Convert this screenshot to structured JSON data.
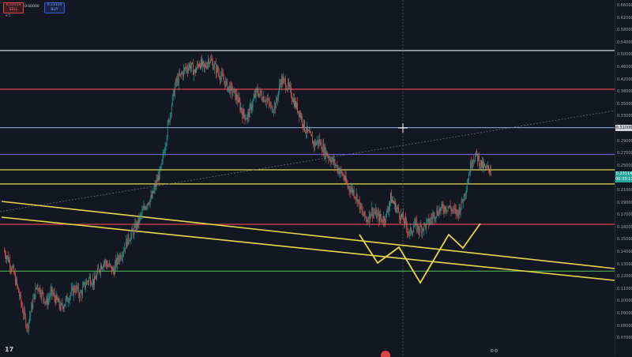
{
  "toolbar": {
    "sell": {
      "price": "0.23114",
      "label": "SELL"
    },
    "spread": "0.00000",
    "buy": {
      "price": "0.23114",
      "label": "BUY"
    },
    "interval": "5"
  },
  "price_axis": {
    "ticks": [
      "0.66000",
      "0.62000",
      "0.58000",
      "0.54000",
      "0.50000",
      "0.46000",
      "0.42000",
      "0.38000",
      "0.35000",
      "0.33000",
      "0.31000",
      "0.29000",
      "0.27000",
      "0.25000",
      "0.23000",
      "0.21000",
      "0.19000",
      "0.17000",
      "0.16000",
      "0.15000",
      "0.14000",
      "0.13000",
      "0.12000",
      "0.11000",
      "0.10000",
      "0.09000",
      "0.08000",
      "0.07000"
    ],
    "crosshair_label": "0.31006",
    "last_price_label": "0.23114",
    "last_price_sub": "00:33:17"
  },
  "colors": {
    "background": "#131722",
    "up_candle": "#26a69a",
    "down_candle": "#ef5350",
    "white_level": "#d1d4dc",
    "red_level": "#e0434b",
    "blue_level": "#7ea7e6",
    "purple_level": "#6a5acd",
    "yellow": "#e6d84a",
    "green_level": "#4caf50"
  },
  "icons": {
    "logo": "tradingview-logo-icon",
    "bottom": "settings-icon"
  },
  "chart_data": {
    "type": "candlestick",
    "y_scale": "log",
    "ylim": [
      0.07,
      0.66
    ],
    "horizontal_levels": [
      {
        "price": 0.495,
        "color": "white"
      },
      {
        "price": 0.385,
        "color": "red"
      },
      {
        "price": 0.3,
        "color": "blue"
      },
      {
        "price": 0.252,
        "color": "purple"
      },
      {
        "price": 0.228,
        "color": "yellow"
      },
      {
        "price": 0.208,
        "color": "yellow"
      },
      {
        "price": 0.16,
        "color": "red"
      },
      {
        "price": 0.118,
        "color": "green"
      }
    ],
    "price_path": [
      0.135,
      0.128,
      0.118,
      0.105,
      0.092,
      0.082,
      0.095,
      0.108,
      0.102,
      0.096,
      0.103,
      0.098,
      0.093,
      0.097,
      0.102,
      0.106,
      0.101,
      0.108,
      0.113,
      0.11,
      0.12,
      0.126,
      0.122,
      0.118,
      0.128,
      0.135,
      0.145,
      0.152,
      0.16,
      0.172,
      0.185,
      0.19,
      0.21,
      0.23,
      0.28,
      0.34,
      0.4,
      0.42,
      0.44,
      0.45,
      0.43,
      0.46,
      0.44,
      0.47,
      0.45,
      0.43,
      0.41,
      0.39,
      0.38,
      0.36,
      0.33,
      0.32,
      0.35,
      0.38,
      0.37,
      0.36,
      0.34,
      0.35,
      0.41,
      0.4,
      0.38,
      0.35,
      0.33,
      0.3,
      0.285,
      0.27,
      0.275,
      0.26,
      0.25,
      0.24,
      0.23,
      0.22,
      0.205,
      0.2,
      0.19,
      0.172,
      0.165,
      0.175,
      0.17,
      0.165,
      0.168,
      0.19,
      0.18,
      0.17,
      0.162,
      0.15,
      0.16,
      0.155,
      0.158,
      0.162,
      0.17,
      0.175,
      0.178,
      0.18,
      0.175,
      0.172,
      0.185,
      0.21,
      0.245,
      0.25,
      0.235,
      0.228,
      0.231
    ]
  }
}
